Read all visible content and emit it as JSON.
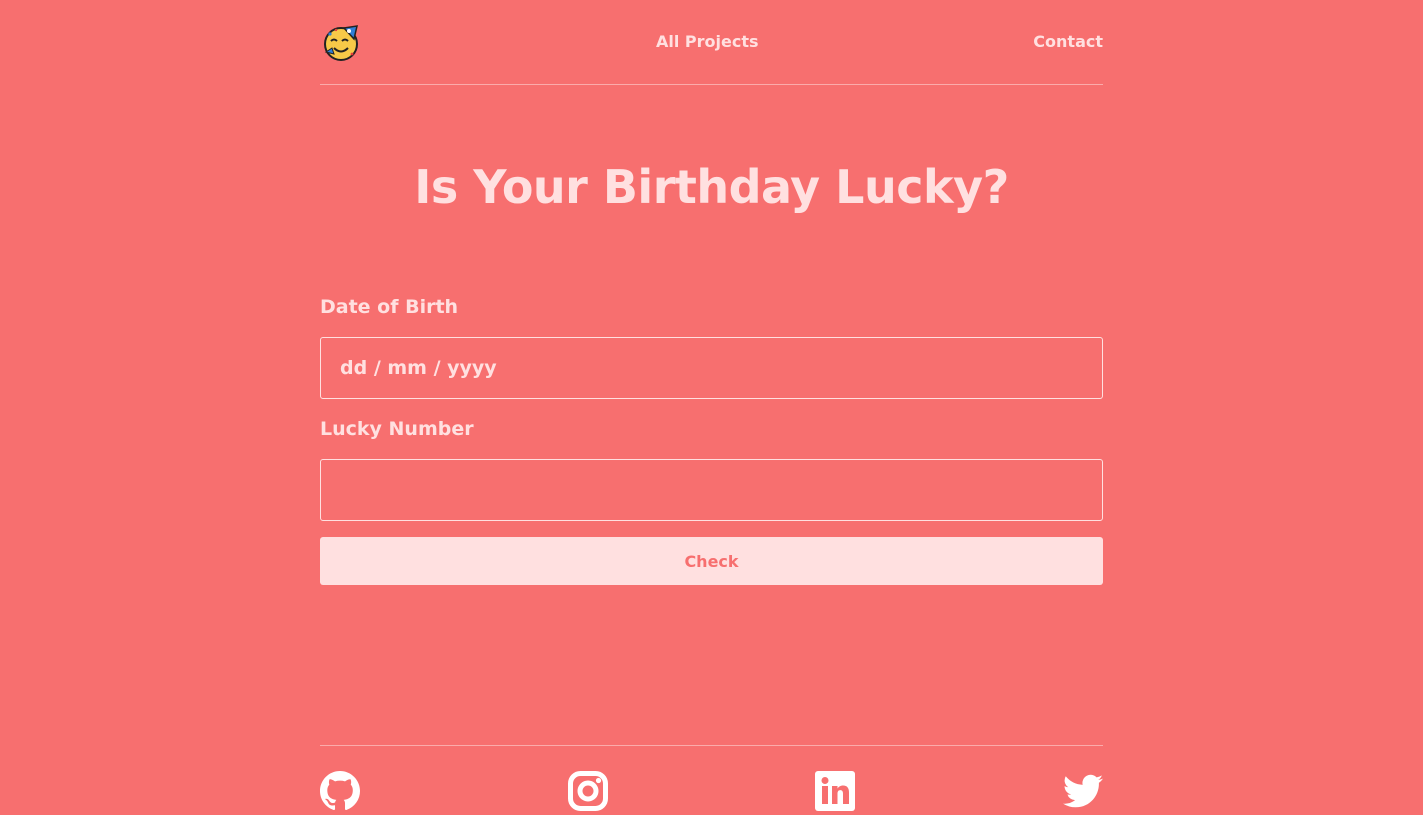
{
  "nav": {
    "logo_icon": "party-face-emoji-icon",
    "all_projects": "All Projects",
    "contact": "Contact"
  },
  "main": {
    "title": "Is Your Birthday Lucky?",
    "dob_label": "Date of Birth",
    "dob_placeholder": "dd / mm / yyyy",
    "lucky_label": "Lucky Number",
    "lucky_value": "",
    "check_button": "Check"
  },
  "footer": {
    "icons": [
      "github-icon",
      "instagram-icon",
      "linkedin-icon",
      "twitter-icon"
    ]
  },
  "colors": {
    "background": "#f76f6f",
    "text": "#ffe0e0",
    "button_bg": "#ffe0e0",
    "button_text": "#f76f6f"
  }
}
